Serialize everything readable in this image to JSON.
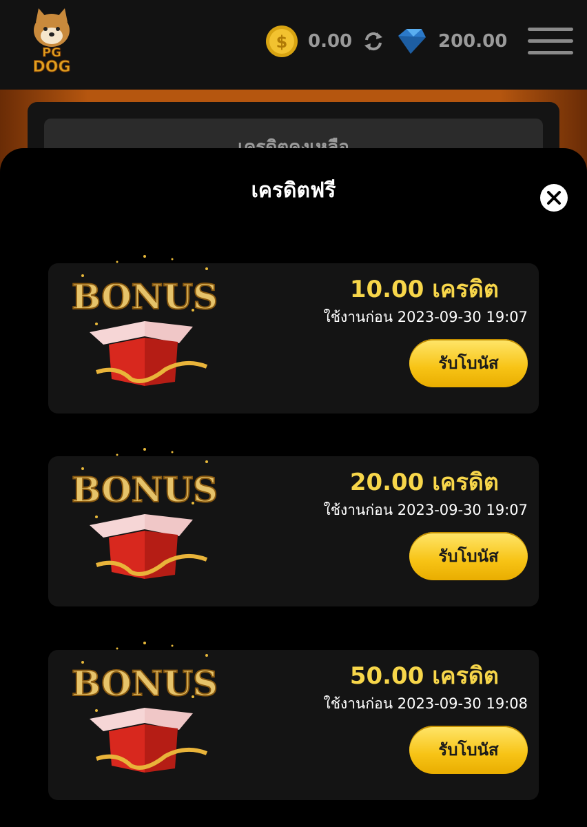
{
  "header": {
    "logo_top": "PG",
    "logo_bottom": "DOG",
    "coin_balance": "0.00",
    "gem_balance": "200.00"
  },
  "background_card_label": "เครดิตคงเหลือ",
  "modal": {
    "title": "เครดิตฟรี"
  },
  "bonus_cards": [
    {
      "amount": "10.00 เครดิต",
      "expiry": "ใช้งานก่อน 2023-09-30 19:07",
      "button": "รับโบนัส",
      "art_text": "BONUS"
    },
    {
      "amount": "20.00 เครดิต",
      "expiry": "ใช้งานก่อน 2023-09-30 19:07",
      "button": "รับโบนัส",
      "art_text": "BONUS"
    },
    {
      "amount": "50.00 เครดิต",
      "expiry": "ใช้งานก่อน 2023-09-30 19:08",
      "button": "รับโบนัส",
      "art_text": "BONUS"
    }
  ],
  "colors": {
    "accent_gold": "#f7d64a",
    "button_yellow": "#f7c315",
    "band_orange": "#b5560f"
  },
  "icons": [
    "dog-logo-icon",
    "coin-icon",
    "refresh-icon",
    "gem-icon",
    "hamburger-menu-icon",
    "close-icon",
    "bonus-gift-icon"
  ]
}
